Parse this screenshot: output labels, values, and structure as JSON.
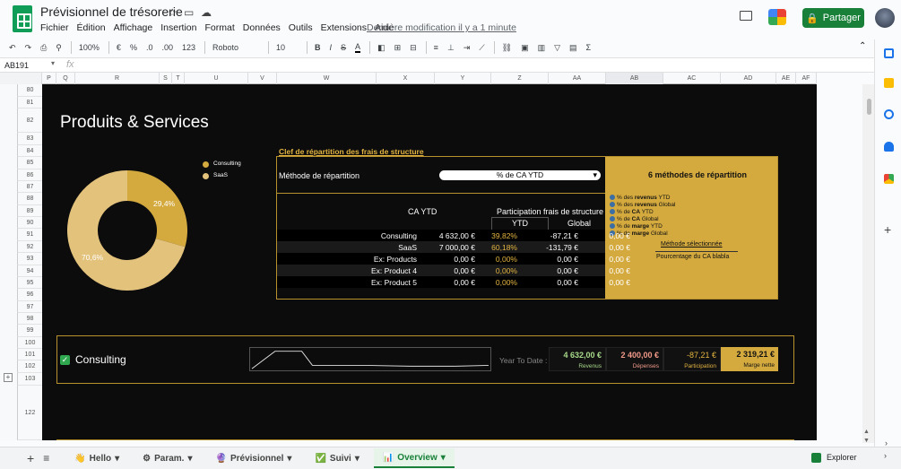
{
  "document": {
    "title": "Prévisionnel de trésorerie",
    "last_modified": "Dernière modification il y a 1 minute",
    "share_label": "Partager"
  },
  "menu": [
    "Fichier",
    "Édition",
    "Affichage",
    "Insertion",
    "Format",
    "Données",
    "Outils",
    "Extensions",
    "Aide"
  ],
  "toolbar": {
    "zoom": "100%",
    "currency": "€",
    "percent": "%",
    "decimal_decrease": ".0",
    "decimal_increase": ".00",
    "number_format": "123",
    "font": "Roboto",
    "font_size": "10"
  },
  "formula_bar": {
    "cell_ref": "AB191",
    "fx": "fx"
  },
  "columns": [
    "P",
    "Q",
    "R",
    "S",
    "T",
    "U",
    "V",
    "W",
    "X",
    "Y",
    "Z",
    "AA",
    "AB",
    "AC",
    "AD",
    "AE",
    "AF"
  ],
  "rows": [
    "80",
    "81",
    "82",
    "83",
    "84",
    "85",
    "86",
    "87",
    "88",
    "89",
    "90",
    "91",
    "92",
    "93",
    "94",
    "95",
    "96",
    "97",
    "98",
    "99",
    "100",
    "101",
    "102",
    "103",
    "122"
  ],
  "dashboard": {
    "section_title": "Produits & Services",
    "legend": [
      "Consulting",
      "SaaS"
    ],
    "pie_labels": {
      "consulting": "29,4%",
      "saas": "70,6%"
    },
    "cle_title": "Clef de répartition des frais de structure",
    "methode_label": "Méthode de répartition",
    "methode_value": "% de CA YTD",
    "gold_title": "6 méthodes de répartition",
    "methods": [
      {
        "n": "1",
        "pre": "% des ",
        "bold": "revenus",
        "post": " YTD"
      },
      {
        "n": "2",
        "pre": "% des ",
        "bold": "revenus",
        "post": " Global"
      },
      {
        "n": "3",
        "pre": "% de ",
        "bold": "CA",
        "post": " YTD"
      },
      {
        "n": "4",
        "pre": "% de ",
        "bold": "CA",
        "post": " Global"
      },
      {
        "n": "5",
        "pre": "% de ",
        "bold": "marge",
        "post": " YTD"
      },
      {
        "n": "6",
        "pre": "% de ",
        "bold": "marge",
        "post": " Global"
      }
    ],
    "selected_label": "Méthode sélectionnée",
    "selected_value": "Pourcentage du CA blabla",
    "ca_ytd_header": "CA YTD",
    "participation_header": "Participation frais de structure",
    "ytd_header": "YTD",
    "global_header": "Global",
    "table": [
      {
        "name": "Consulting",
        "ca": "4 632,00 €",
        "pct": "39,82%",
        "ytd": "-87,21 €",
        "global": "0,00 €"
      },
      {
        "name": "SaaS",
        "ca": "7 000,00 €",
        "pct": "60,18%",
        "ytd": "-131,79 €",
        "global": "0,00 €"
      },
      {
        "name": "Ex: Products",
        "ca": "0,00 €",
        "pct": "0,00%",
        "ytd": "0,00 €",
        "global": "0,00 €"
      },
      {
        "name": "Ex: Product 4",
        "ca": "0,00 €",
        "pct": "0,00%",
        "ytd": "0,00 €",
        "global": "0,00 €"
      },
      {
        "name": "Ex: Product 5",
        "ca": "0,00 €",
        "pct": "0,00%",
        "ytd": "0,00 €",
        "global": "0,00 €"
      }
    ],
    "consulting": {
      "label": "Consulting",
      "ytd_label": "Year To Date :",
      "revenus": "4 632,00 €",
      "revenus_label": "Revenus",
      "depenses": "2 400,00 €",
      "depenses_label": "Dépenses",
      "participation": "-87,21 €",
      "participation_label": "Participation",
      "marge": "2 319,21 €",
      "marge_label": "Marge nette"
    }
  },
  "sheet_tabs": [
    {
      "label": "Hello",
      "emoji": "👋"
    },
    {
      "label": "Param.",
      "emoji": "⚙"
    },
    {
      "label": "Prévisionnel",
      "emoji": "🔮"
    },
    {
      "label": "Suivi",
      "emoji": "✅"
    },
    {
      "label": "Overview",
      "emoji": "📊"
    }
  ],
  "active_tab": "Overview",
  "explorer_label": "Explorer",
  "colors": {
    "gold": "#d4aa3f",
    "pie_consulting": "#d4aa3f",
    "pie_saas": "#e3c27c",
    "dark_bg": "#0c0c0c",
    "green": "#188038"
  },
  "chart_data": {
    "type": "pie",
    "categories": [
      "Consulting",
      "SaaS"
    ],
    "values": [
      29.4,
      70.6
    ],
    "donut": true
  }
}
